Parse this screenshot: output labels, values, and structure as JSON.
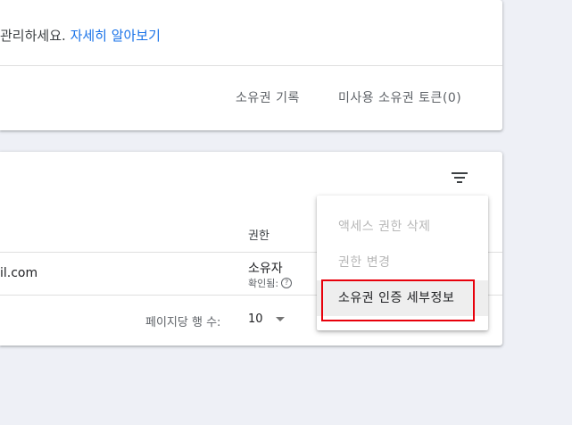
{
  "top_card": {
    "description_prefix": "관리하세요.",
    "learn_more": "자세히 알아보기",
    "ownership_history": "소유권 기록",
    "unused_tokens": "미사용 소유권 토큰(0)"
  },
  "users_table": {
    "headers": {
      "permission": "권한"
    },
    "rows": [
      {
        "email": "il.com",
        "permission": "소유자",
        "verified_label": "확인됨:"
      }
    ],
    "pager": {
      "label": "페이지당 행 수:",
      "value": "10"
    }
  },
  "context_menu": {
    "items": [
      {
        "label": "액세스 권한 삭제",
        "enabled": false
      },
      {
        "label": "권한 변경",
        "enabled": false
      },
      {
        "label": "소유권 인증 세부정보",
        "enabled": true,
        "highlighted": true
      }
    ]
  },
  "icons": {
    "filter": "filter-icon",
    "help": "help-icon",
    "dropdown": "caret-down-icon"
  },
  "colors": {
    "link": "#1a73e8",
    "highlight_box": "#e8000b",
    "background": "#eef0f6"
  }
}
